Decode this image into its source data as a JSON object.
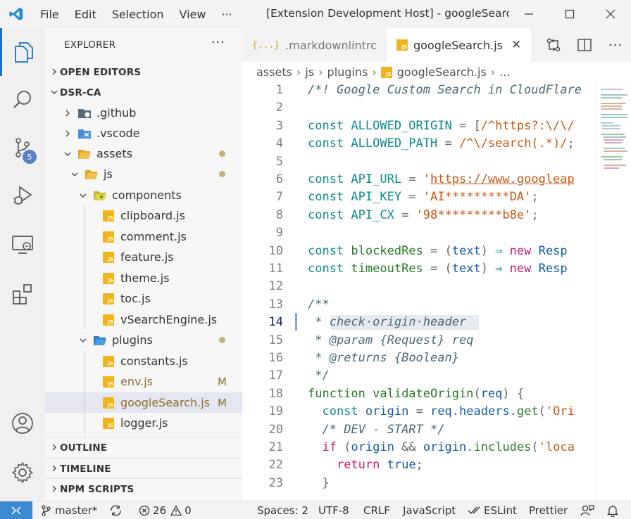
{
  "titlebar": {
    "menu": [
      "File",
      "Edit",
      "Selection",
      "View",
      "···"
    ],
    "title": "[Extension Development Host] - googleSearch.js - DSR-CA"
  },
  "activity": {
    "scm_badge": "5"
  },
  "sidebar": {
    "title": "EXPLORER",
    "more": "···",
    "sections": {
      "open_editors": "OPEN EDITORS",
      "root": "DSR-CA",
      "outline": "OUTLINE",
      "timeline": "TIMELINE",
      "npm": "NPM SCRIPTS"
    },
    "tree": {
      "github": ".github",
      "vscode": ".vscode",
      "assets": "assets",
      "js": "js",
      "components": "components",
      "clipboard": "clipboard.js",
      "comment": "comment.js",
      "feature": "feature.js",
      "theme": "theme.js",
      "toc": "toc.js",
      "vsearch": "vSearchEngine.js",
      "plugins": "plugins",
      "constants": "constants.js",
      "env": "env.js",
      "env_mark": "M",
      "google": "googleSearch.js",
      "google_mark": "M",
      "logger": "logger.js"
    }
  },
  "tabs": [
    {
      "label": ".markdownlintrc",
      "icon": "{...}"
    },
    {
      "label": "googleSearch.js",
      "icon": "JS"
    }
  ],
  "breadcrumb": [
    "assets",
    "js",
    "plugins",
    "googleSearch.js",
    "..."
  ],
  "editor": {
    "line_numbers": [
      "1",
      "2",
      "3",
      "4",
      "5",
      "6",
      "7",
      "8",
      "9",
      "10",
      "11",
      "12",
      "13",
      "14",
      "15",
      "16",
      "17",
      "18",
      "19",
      "20",
      "21",
      "22",
      "23"
    ]
  },
  "statusbar": {
    "branch": "master*",
    "errors": "26",
    "warnings": "0",
    "spaces": "Spaces: 2",
    "encoding": "UTF-8",
    "eol": "CRLF",
    "language": "JavaScript",
    "eslint": "ESLint",
    "prettier": "Prettier"
  }
}
